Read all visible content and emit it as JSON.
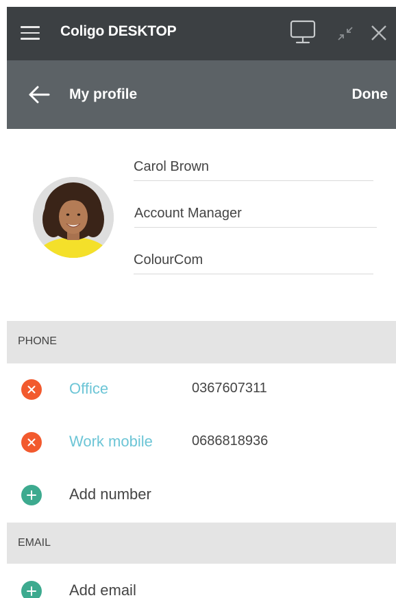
{
  "window": {
    "title": "Coligo DESKTOP",
    "icons": [
      "menu-icon",
      "desktop-icon",
      "collapse-icon",
      "close-icon"
    ]
  },
  "header": {
    "title": "My profile",
    "done_label": "Done"
  },
  "profile": {
    "name": "Carol Brown",
    "role": "Account Manager",
    "company": "ColourCom"
  },
  "phone": {
    "section_label": "PHONE",
    "entries": [
      {
        "label": "Office",
        "number": "0367607311"
      },
      {
        "label": "Work mobile",
        "number": "0686818936"
      }
    ],
    "add_label": "Add number"
  },
  "email": {
    "section_label": "EMAIL",
    "add_label": "Add email"
  },
  "colors": {
    "title_bar": "#3c4043",
    "header_bar": "#5c6266",
    "accent_label": "#6cc5d6",
    "remove_icon": "#f25a2e",
    "add_icon": "#3daa8f",
    "section_bg": "#e4e4e4"
  }
}
